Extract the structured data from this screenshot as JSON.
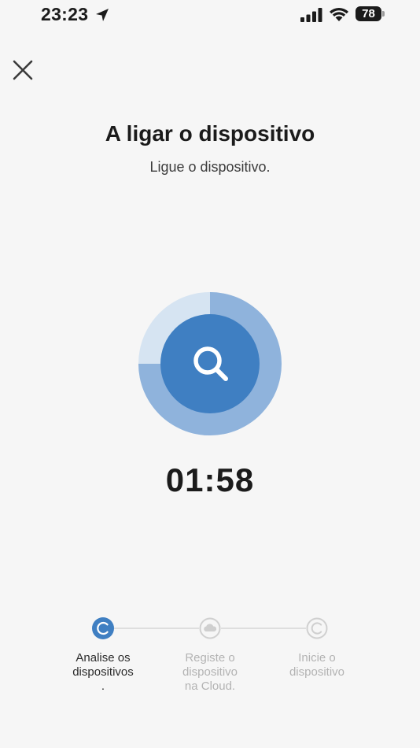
{
  "status_bar": {
    "time": "23:23",
    "battery": "78"
  },
  "icons": {
    "close": "close-icon",
    "search": "search-icon",
    "location": "location-arrow-icon",
    "signal": "cellular-signal-icon",
    "wifi": "wifi-icon",
    "cloud": "cloud-icon"
  },
  "header": {
    "title": "A ligar o dispositivo",
    "subtitle": "Ligue o dispositivo."
  },
  "scan": {
    "countdown": "01:58",
    "progress_fraction": 0.75
  },
  "steps": [
    {
      "label": "Analise os\ndispositivos\n.",
      "state": "active",
      "icon": "refresh-icon"
    },
    {
      "label": "Registe o\ndispositivo\nna Cloud.",
      "state": "inactive",
      "icon": "cloud-icon"
    },
    {
      "label": "Inicie o\ndispositivo",
      "state": "inactive",
      "icon": "refresh-icon"
    }
  ],
  "colors": {
    "accent": "#3f7fc2",
    "accent_ring": "#9dbfe2",
    "background": "#f6f6f6",
    "inactive": "#cfcfcf"
  }
}
